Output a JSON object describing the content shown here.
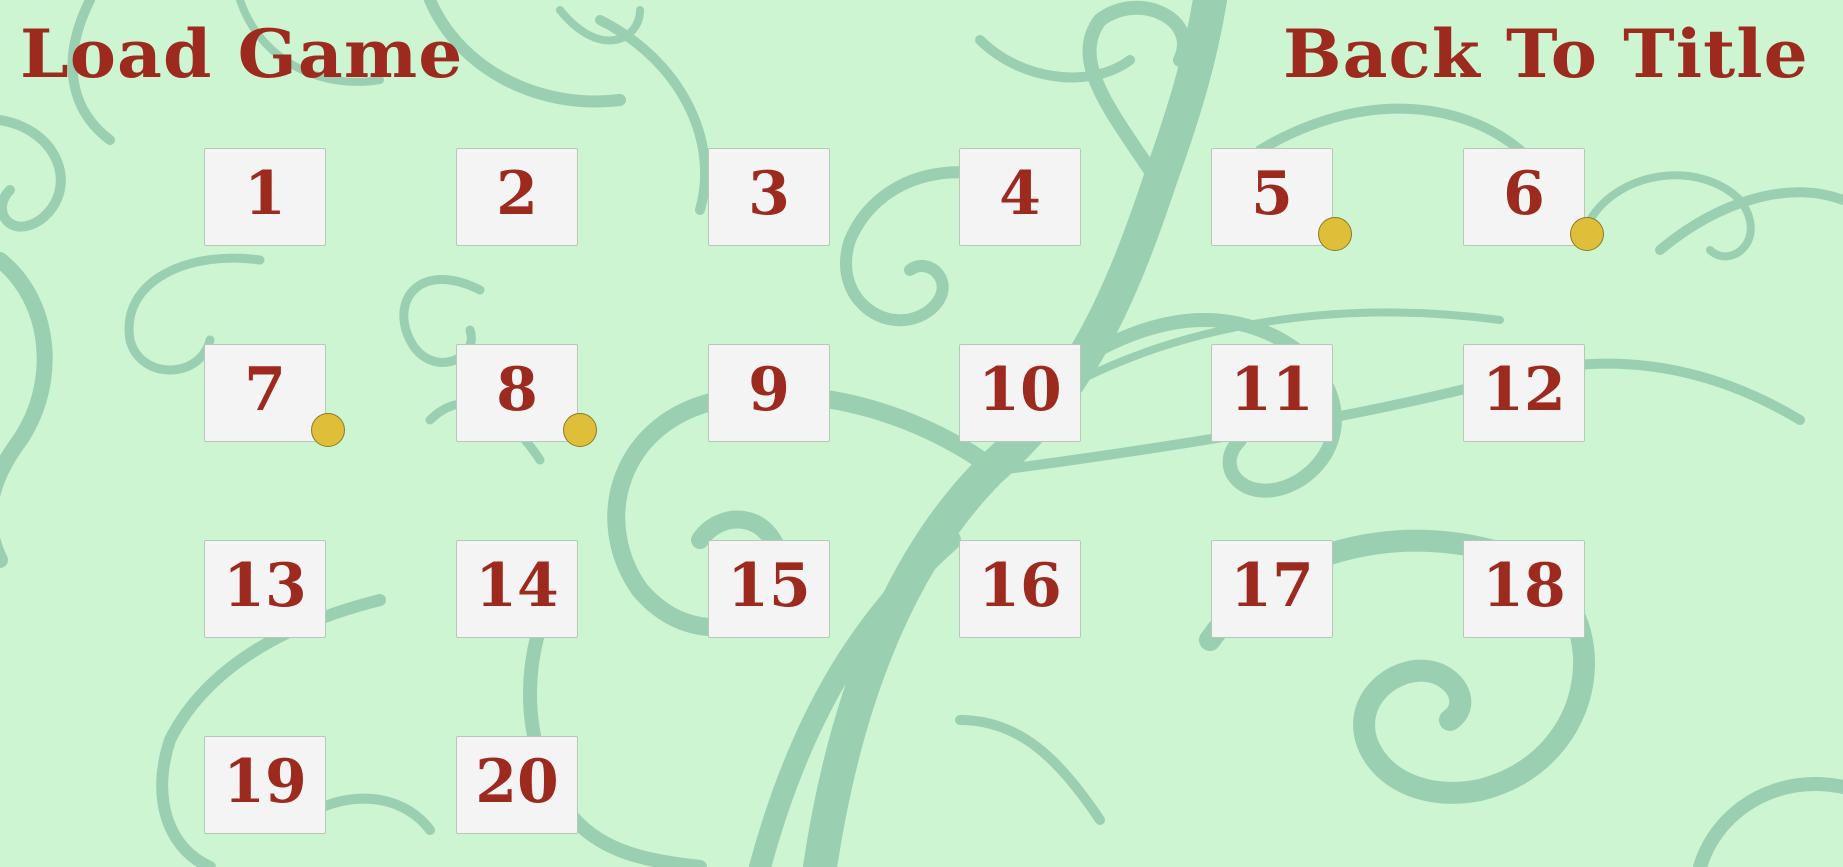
{
  "header": {
    "title": "Load Game",
    "back_label": "Back To Title"
  },
  "colors": {
    "background": "#cdf5d2",
    "ornament": "#9bcfb1",
    "text": "#9c2a1e",
    "slot": "#f4f4f4",
    "save_marker": "#dfbe3a"
  },
  "slots": [
    {
      "label": "1",
      "saved": false
    },
    {
      "label": "2",
      "saved": false
    },
    {
      "label": "3",
      "saved": false
    },
    {
      "label": "4",
      "saved": false
    },
    {
      "label": "5",
      "saved": true
    },
    {
      "label": "6",
      "saved": true
    },
    {
      "label": "7",
      "saved": true
    },
    {
      "label": "8",
      "saved": true
    },
    {
      "label": "9",
      "saved": false
    },
    {
      "label": "10",
      "saved": false
    },
    {
      "label": "11",
      "saved": false
    },
    {
      "label": "12",
      "saved": false
    },
    {
      "label": "13",
      "saved": false
    },
    {
      "label": "14",
      "saved": false
    },
    {
      "label": "15",
      "saved": false
    },
    {
      "label": "16",
      "saved": false
    },
    {
      "label": "17",
      "saved": false
    },
    {
      "label": "18",
      "saved": false
    },
    {
      "label": "19",
      "saved": false
    },
    {
      "label": "20",
      "saved": false
    }
  ]
}
